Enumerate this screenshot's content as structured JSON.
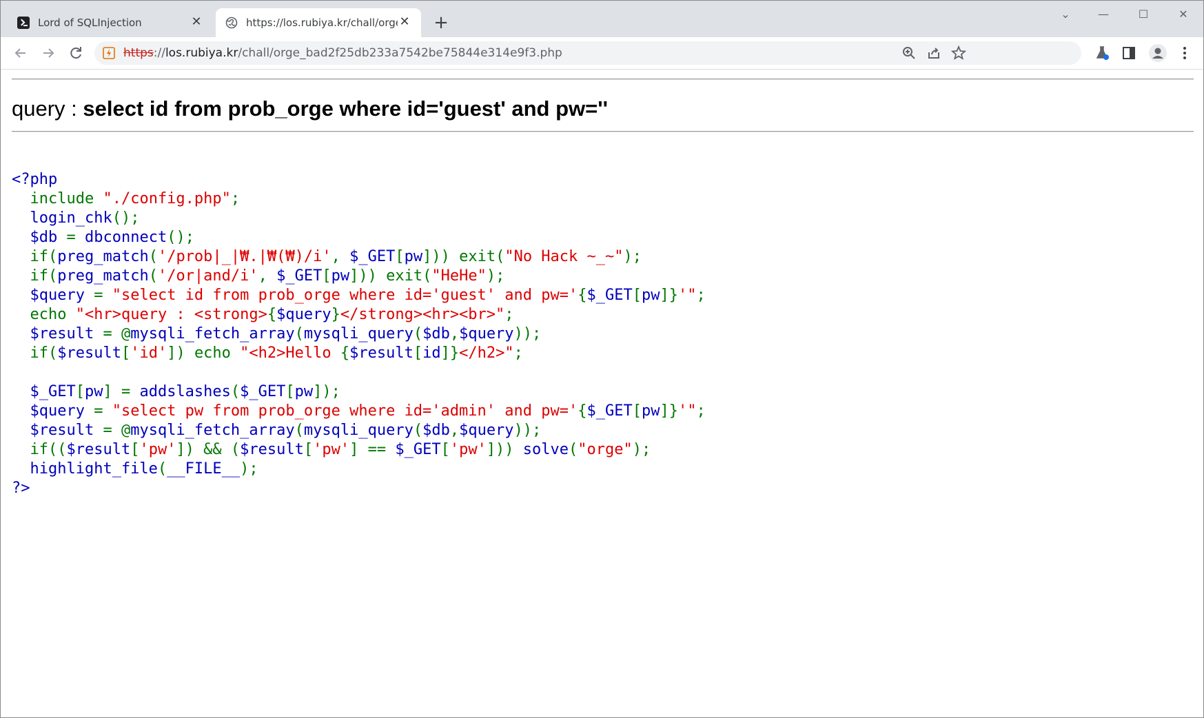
{
  "browser": {
    "tabs": [
      {
        "title": "Lord of SQLInjection",
        "active": false,
        "icon": "terminal-icon"
      },
      {
        "title": "https://los.rubiya.kr/chall/orge_b",
        "active": true,
        "icon": "globe-icon"
      }
    ],
    "new_tab_label": "+",
    "window_controls": {
      "dropdown": "⌄",
      "minimize": "—",
      "maximize": "☐",
      "close": "✕"
    },
    "url": {
      "scheme": "https",
      "separator": "://",
      "host": "los.rubiya.kr",
      "path": "/chall/orge_bad2f25db233a7542be75844e314e9f3.php"
    }
  },
  "page": {
    "query_prefix": "query : ",
    "query_text": "select id from prob_orge where id='guest' and pw=''",
    "code_lines": [
      [
        {
          "c": "default",
          "t": "<?php"
        }
      ],
      [
        {
          "c": "default",
          "t": "  "
        },
        {
          "c": "keyword",
          "t": "include "
        },
        {
          "c": "string",
          "t": "\"./config.php\""
        },
        {
          "c": "keyword",
          "t": ";"
        }
      ],
      [
        {
          "c": "default",
          "t": "  login_chk"
        },
        {
          "c": "keyword",
          "t": "();"
        }
      ],
      [
        {
          "c": "default",
          "t": "  $db "
        },
        {
          "c": "keyword",
          "t": "= "
        },
        {
          "c": "default",
          "t": "dbconnect"
        },
        {
          "c": "keyword",
          "t": "();"
        }
      ],
      [
        {
          "c": "default",
          "t": "  "
        },
        {
          "c": "keyword",
          "t": "if("
        },
        {
          "c": "default",
          "t": "preg_match"
        },
        {
          "c": "keyword",
          "t": "("
        },
        {
          "c": "string",
          "t": "'/prob|_|₩.|₩(₩)/i'"
        },
        {
          "c": "keyword",
          "t": ", "
        },
        {
          "c": "default",
          "t": "$_GET"
        },
        {
          "c": "keyword",
          "t": "["
        },
        {
          "c": "default",
          "t": "pw"
        },
        {
          "c": "keyword",
          "t": "])) exit("
        },
        {
          "c": "string",
          "t": "\"No Hack ~_~\""
        },
        {
          "c": "keyword",
          "t": ");"
        }
      ],
      [
        {
          "c": "default",
          "t": "  "
        },
        {
          "c": "keyword",
          "t": "if("
        },
        {
          "c": "default",
          "t": "preg_match"
        },
        {
          "c": "keyword",
          "t": "("
        },
        {
          "c": "string",
          "t": "'/or|and/i'"
        },
        {
          "c": "keyword",
          "t": ", "
        },
        {
          "c": "default",
          "t": "$_GET"
        },
        {
          "c": "keyword",
          "t": "["
        },
        {
          "c": "default",
          "t": "pw"
        },
        {
          "c": "keyword",
          "t": "])) exit("
        },
        {
          "c": "string",
          "t": "\"HeHe\""
        },
        {
          "c": "keyword",
          "t": ");"
        }
      ],
      [
        {
          "c": "default",
          "t": "  $query "
        },
        {
          "c": "keyword",
          "t": "= "
        },
        {
          "c": "string",
          "t": "\"select id from prob_orge where id='guest' and pw='"
        },
        {
          "c": "keyword",
          "t": "{"
        },
        {
          "c": "default",
          "t": "$_GET"
        },
        {
          "c": "keyword",
          "t": "["
        },
        {
          "c": "default",
          "t": "pw"
        },
        {
          "c": "keyword",
          "t": "]}"
        },
        {
          "c": "string",
          "t": "'\""
        },
        {
          "c": "keyword",
          "t": ";"
        }
      ],
      [
        {
          "c": "default",
          "t": "  "
        },
        {
          "c": "keyword",
          "t": "echo "
        },
        {
          "c": "string",
          "t": "\"<hr>query : <strong>"
        },
        {
          "c": "keyword",
          "t": "{"
        },
        {
          "c": "default",
          "t": "$query"
        },
        {
          "c": "keyword",
          "t": "}"
        },
        {
          "c": "string",
          "t": "</strong><hr><br>\""
        },
        {
          "c": "keyword",
          "t": ";"
        }
      ],
      [
        {
          "c": "default",
          "t": "  $result "
        },
        {
          "c": "keyword",
          "t": "= @"
        },
        {
          "c": "default",
          "t": "mysqli_fetch_array"
        },
        {
          "c": "keyword",
          "t": "("
        },
        {
          "c": "default",
          "t": "mysqli_query"
        },
        {
          "c": "keyword",
          "t": "("
        },
        {
          "c": "default",
          "t": "$db"
        },
        {
          "c": "keyword",
          "t": ","
        },
        {
          "c": "default",
          "t": "$query"
        },
        {
          "c": "keyword",
          "t": "));"
        }
      ],
      [
        {
          "c": "default",
          "t": "  "
        },
        {
          "c": "keyword",
          "t": "if("
        },
        {
          "c": "default",
          "t": "$result"
        },
        {
          "c": "keyword",
          "t": "["
        },
        {
          "c": "string",
          "t": "'id'"
        },
        {
          "c": "keyword",
          "t": "]) echo "
        },
        {
          "c": "string",
          "t": "\"<h2>Hello "
        },
        {
          "c": "keyword",
          "t": "{"
        },
        {
          "c": "default",
          "t": "$result"
        },
        {
          "c": "keyword",
          "t": "["
        },
        {
          "c": "default",
          "t": "id"
        },
        {
          "c": "keyword",
          "t": "]}"
        },
        {
          "c": "string",
          "t": "</h2>\""
        },
        {
          "c": "keyword",
          "t": ";"
        }
      ],
      [
        {
          "c": "default",
          "t": ""
        }
      ],
      [
        {
          "c": "default",
          "t": "  $_GET"
        },
        {
          "c": "keyword",
          "t": "["
        },
        {
          "c": "default",
          "t": "pw"
        },
        {
          "c": "keyword",
          "t": "] = "
        },
        {
          "c": "default",
          "t": "addslashes"
        },
        {
          "c": "keyword",
          "t": "("
        },
        {
          "c": "default",
          "t": "$_GET"
        },
        {
          "c": "keyword",
          "t": "["
        },
        {
          "c": "default",
          "t": "pw"
        },
        {
          "c": "keyword",
          "t": "]);"
        }
      ],
      [
        {
          "c": "default",
          "t": "  $query "
        },
        {
          "c": "keyword",
          "t": "= "
        },
        {
          "c": "string",
          "t": "\"select pw from prob_orge where id='admin' and pw='"
        },
        {
          "c": "keyword",
          "t": "{"
        },
        {
          "c": "default",
          "t": "$_GET"
        },
        {
          "c": "keyword",
          "t": "["
        },
        {
          "c": "default",
          "t": "pw"
        },
        {
          "c": "keyword",
          "t": "]}"
        },
        {
          "c": "string",
          "t": "'\""
        },
        {
          "c": "keyword",
          "t": ";"
        }
      ],
      [
        {
          "c": "default",
          "t": "  $result "
        },
        {
          "c": "keyword",
          "t": "= @"
        },
        {
          "c": "default",
          "t": "mysqli_fetch_array"
        },
        {
          "c": "keyword",
          "t": "("
        },
        {
          "c": "default",
          "t": "mysqli_query"
        },
        {
          "c": "keyword",
          "t": "("
        },
        {
          "c": "default",
          "t": "$db"
        },
        {
          "c": "keyword",
          "t": ","
        },
        {
          "c": "default",
          "t": "$query"
        },
        {
          "c": "keyword",
          "t": "));"
        }
      ],
      [
        {
          "c": "default",
          "t": "  "
        },
        {
          "c": "keyword",
          "t": "if(("
        },
        {
          "c": "default",
          "t": "$result"
        },
        {
          "c": "keyword",
          "t": "["
        },
        {
          "c": "string",
          "t": "'pw'"
        },
        {
          "c": "keyword",
          "t": "]) && ("
        },
        {
          "c": "default",
          "t": "$result"
        },
        {
          "c": "keyword",
          "t": "["
        },
        {
          "c": "string",
          "t": "'pw'"
        },
        {
          "c": "keyword",
          "t": "] == "
        },
        {
          "c": "default",
          "t": "$_GET"
        },
        {
          "c": "keyword",
          "t": "["
        },
        {
          "c": "string",
          "t": "'pw'"
        },
        {
          "c": "keyword",
          "t": "])) "
        },
        {
          "c": "default",
          "t": "solve"
        },
        {
          "c": "keyword",
          "t": "("
        },
        {
          "c": "string",
          "t": "\"orge\""
        },
        {
          "c": "keyword",
          "t": ");"
        }
      ],
      [
        {
          "c": "default",
          "t": "  highlight_file"
        },
        {
          "c": "keyword",
          "t": "("
        },
        {
          "c": "default",
          "t": "__FILE__"
        },
        {
          "c": "keyword",
          "t": ");"
        }
      ],
      [
        {
          "c": "default",
          "t": "?>"
        }
      ]
    ]
  },
  "colors": {
    "php_default": "#0000bb",
    "php_keyword": "#007700",
    "php_string": "#dd0000",
    "tabstrip_bg": "#dee1e6",
    "omnibox_bg": "#f1f3f4",
    "insecure_scheme": "#c5221f"
  }
}
